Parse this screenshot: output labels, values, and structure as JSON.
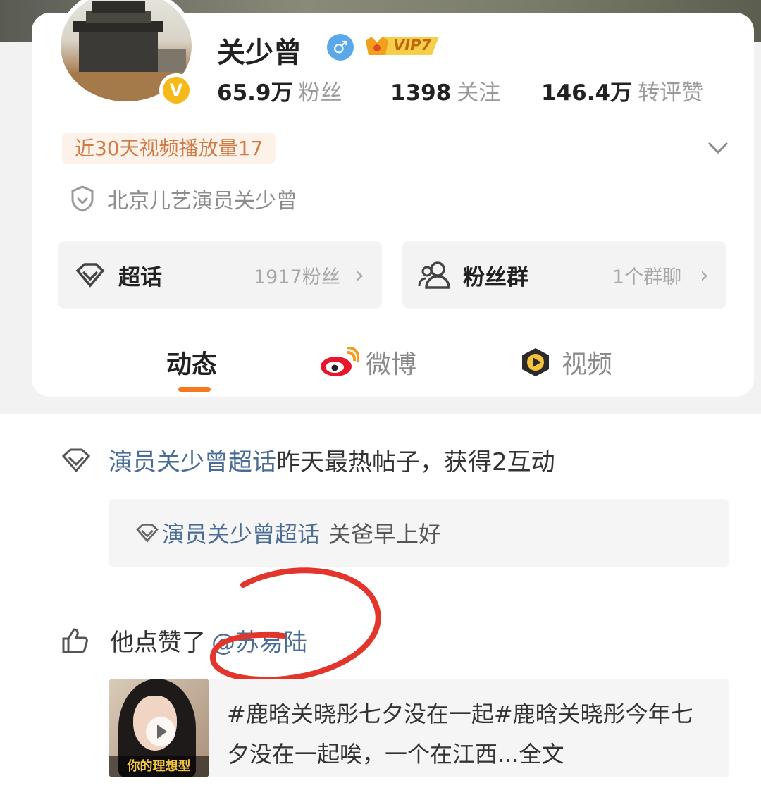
{
  "profile": {
    "name": "关少曾",
    "vip_label": "VIP7",
    "verified_badge": "V",
    "stats": [
      {
        "value": "65.9万",
        "label": "粉丝"
      },
      {
        "value": "1398",
        "label": "关注"
      },
      {
        "value": "146.4万",
        "label": "转评赞"
      }
    ],
    "play_tag": "近30天视频播放量17",
    "verification": "北京儿艺演员关少曾"
  },
  "boxes": {
    "super_topic": {
      "title": "超话",
      "sub": "1917粉丝",
      "chevron": "›"
    },
    "fan_group": {
      "title": "粉丝群",
      "sub": "1个群聊",
      "chevron": "›"
    }
  },
  "tabs": [
    "动态",
    "微博",
    "视频"
  ],
  "feed": {
    "item1": {
      "topic_link": "演员关少曾超话",
      "text": "昨天最热帖子，获得2互动",
      "quote_link": "演员关少曾超话",
      "quote_text": "关爸早上好"
    },
    "item2": {
      "text": "他点赞了",
      "mention": "@苏易陆",
      "thumb_caption": "你的理想型",
      "content": "#鹿晗关晓彤七夕没在一起#鹿晗关晓彤今年七夕没在一起唉，一个在江西...全文"
    }
  },
  "icons": {
    "gender": "male-icon",
    "vip": "crown-icon",
    "verify": "shield-icon",
    "super_topic": "diamond-icon",
    "fans": "people-icon",
    "weibo": "weibo-icon",
    "video": "video-icon",
    "like": "thumbs-up-icon",
    "expand": "chevron-down-icon"
  },
  "colors": {
    "accent": "#f57a1e",
    "link": "#4a6d96",
    "annotation": "#e2352b"
  }
}
